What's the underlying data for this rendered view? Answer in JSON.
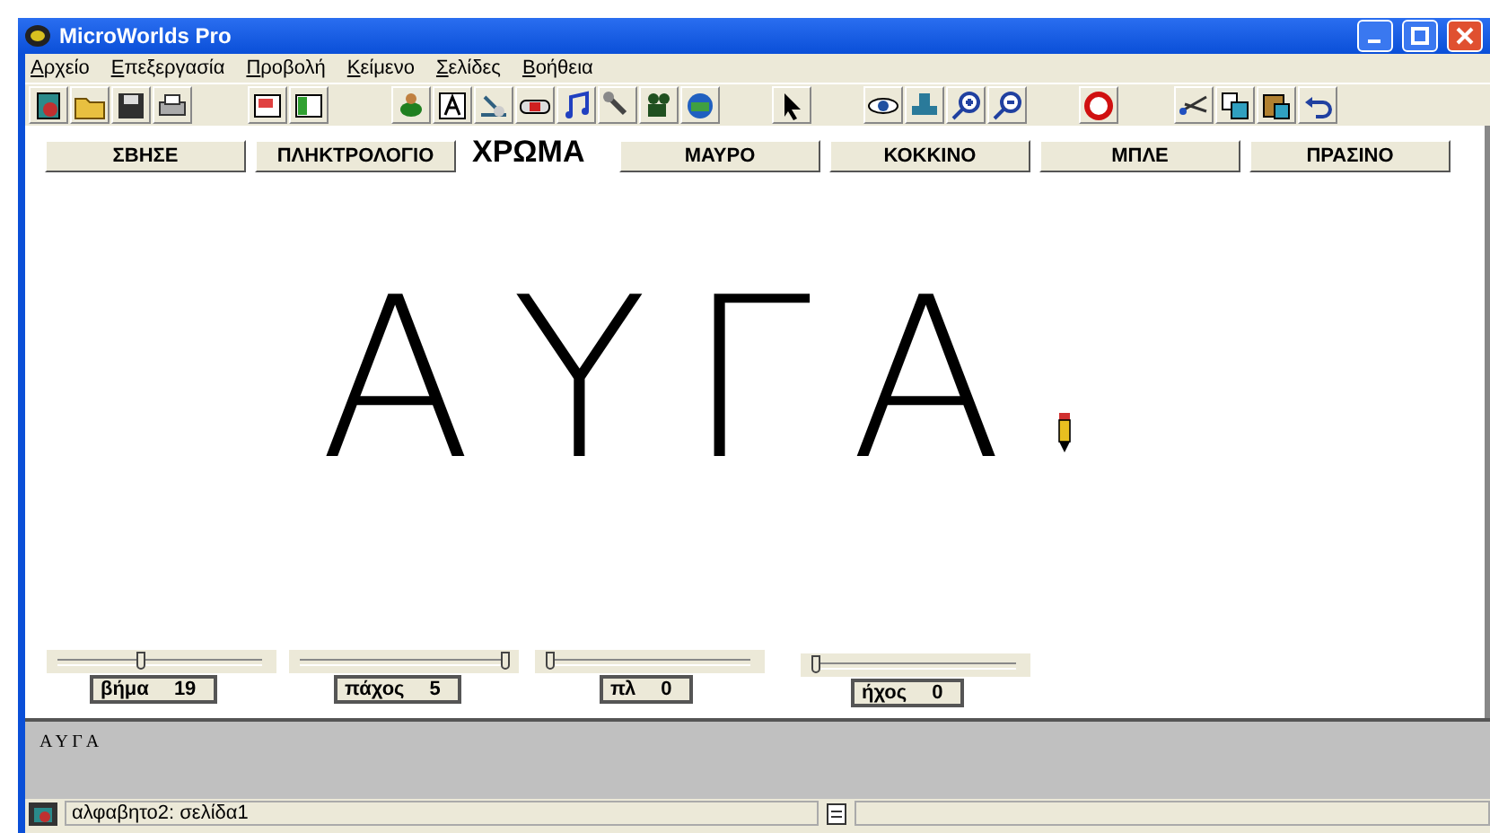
{
  "window": {
    "title": "MicroWorlds Pro"
  },
  "menu": [
    "Αρχείο",
    "Επεξεργασία",
    "Προβολή",
    "Κείμενο",
    "Σελίδες",
    "Βοήθεια"
  ],
  "page_buttons": [
    {
      "label": "ΣΒΗΣΕ",
      "kind": "button"
    },
    {
      "label": "ΠΛΗΚΤΡΟΛΟΓΙΟ",
      "kind": "button"
    },
    {
      "label": "ΧΡΩΜΑ",
      "kind": "text"
    },
    {
      "label": "ΜΑΥΡΟ",
      "kind": "button"
    },
    {
      "label": "ΚΟΚΚΙΝΟ",
      "kind": "button"
    },
    {
      "label": "ΜΠΛΕ",
      "kind": "button"
    },
    {
      "label": "ΠΡΑΣΙΝΟ",
      "kind": "button"
    }
  ],
  "drawing_text": "ΑΥΓΑ",
  "sliders": [
    {
      "name": "βήμα",
      "value": "19",
      "level": 0.39
    },
    {
      "name": "πάχος",
      "value": "5",
      "level": 1
    },
    {
      "name": "πλ",
      "value": "0",
      "level": 0
    },
    {
      "name": "ήχος",
      "value": "0",
      "level": 0
    }
  ],
  "command_center": {
    "text": "Α Υ Γ Α"
  },
  "status_bar": {
    "page": "αλφαβητο2: σελίδα1"
  }
}
